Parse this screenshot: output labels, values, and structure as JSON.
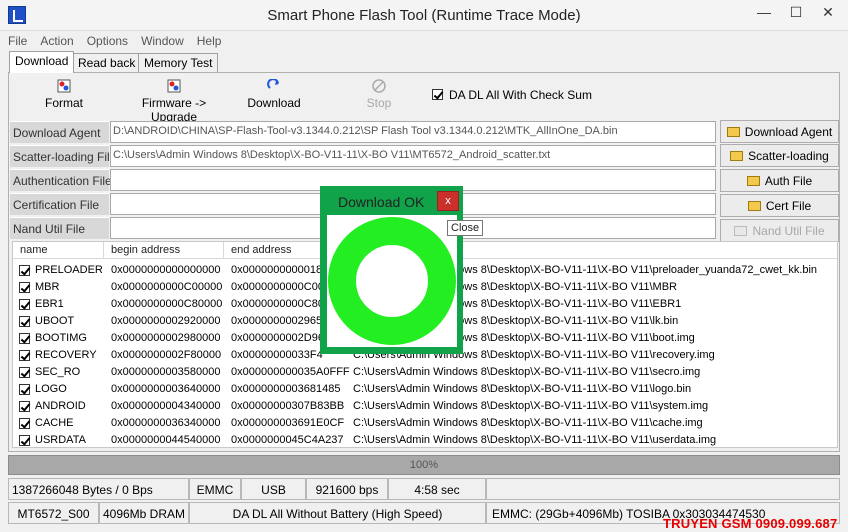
{
  "window": {
    "title": "Smart Phone Flash Tool (Runtime Trace Mode)",
    "minimize": "—",
    "maximize": "☐",
    "close": "✕"
  },
  "menu": [
    "File",
    "Action",
    "Options",
    "Window",
    "Help"
  ],
  "tabs": [
    "Download",
    "Read back",
    "Memory Test"
  ],
  "toolbar": {
    "format": "Format",
    "firmware_upgrade": "Firmware -> Upgrade",
    "download": "Download",
    "stop": "Stop",
    "checksum_label": "DA DL All With Check Sum"
  },
  "fields": [
    {
      "label": "Download Agent",
      "value": "D:\\ANDROID\\CHINA\\SP-Flash-Tool-v3.1344.0.212\\SP Flash Tool v3.1344.0.212\\MTK_AllInOne_DA.bin",
      "button": "Download Agent"
    },
    {
      "label": "Scatter-loading File",
      "value": "C:\\Users\\Admin Windows 8\\Desktop\\X-BO-V11-11\\X-BO V11\\MT6572_Android_scatter.txt",
      "button": "Scatter-loading"
    },
    {
      "label": "Authentication File",
      "value": "",
      "button": "Auth File"
    },
    {
      "label": "Certification File",
      "value": "",
      "button": "Cert File"
    },
    {
      "label": "Nand Util File",
      "value": "",
      "button": "Nand Util File"
    }
  ],
  "grid": {
    "headers": [
      "name",
      "begin address",
      "end address",
      "location"
    ],
    "rows": [
      {
        "name": "PRELOADER",
        "begin": "0x0000000000000000",
        "end": "0x000000000001812",
        "location": "C:\\Users\\Admin Windows 8\\Desktop\\X-BO-V11-11\\X-BO V11\\preloader_yuanda72_cwet_kk.bin"
      },
      {
        "name": "MBR",
        "begin": "0x0000000000C00000",
        "end": "0x0000000000C0000",
        "location": "C:\\Users\\Admin Windows 8\\Desktop\\X-BO-V11-11\\X-BO V11\\MBR"
      },
      {
        "name": "EBR1",
        "begin": "0x0000000000C80000",
        "end": "0x0000000000C8000",
        "location": "C:\\Users\\Admin Windows 8\\Desktop\\X-BO-V11-11\\X-BO V11\\EBR1"
      },
      {
        "name": "UBOOT",
        "begin": "0x0000000002920000",
        "end": "0x0000000002965",
        "location": "C:\\Users\\Admin Windows 8\\Desktop\\X-BO-V11-11\\X-BO V11\\lk.bin"
      },
      {
        "name": "BOOTIMG",
        "begin": "0x0000000002980000",
        "end": "0x0000000002D96",
        "location": "C:\\Users\\Admin Windows 8\\Desktop\\X-BO-V11-11\\X-BO V11\\boot.img"
      },
      {
        "name": "RECOVERY",
        "begin": "0x0000000002F80000",
        "end": "0x00000000033F4",
        "location": "C:\\Users\\Admin Windows 8\\Desktop\\X-BO-V11-11\\X-BO V11\\recovery.img"
      },
      {
        "name": "SEC_RO",
        "begin": "0x0000000003580000",
        "end": "0x000000000035A0FFF",
        "location": "C:\\Users\\Admin Windows 8\\Desktop\\X-BO-V11-11\\X-BO V11\\secro.img"
      },
      {
        "name": "LOGO",
        "begin": "0x0000000003640000",
        "end": "0x0000000003681485",
        "location": "C:\\Users\\Admin Windows 8\\Desktop\\X-BO-V11-11\\X-BO V11\\logo.bin"
      },
      {
        "name": "ANDROID",
        "begin": "0x0000000004340000",
        "end": "0x00000000307B83BB",
        "location": "C:\\Users\\Admin Windows 8\\Desktop\\X-BO-V11-11\\X-BO V11\\system.img"
      },
      {
        "name": "CACHE",
        "begin": "0x0000000036340000",
        "end": "0x000000003691E0CF",
        "location": "C:\\Users\\Admin Windows 8\\Desktop\\X-BO-V11-11\\X-BO V11\\cache.img"
      },
      {
        "name": "USRDATA",
        "begin": "0x0000000044540000",
        "end": "0x0000000045C4A237",
        "location": "C:\\Users\\Admin Windows 8\\Desktop\\X-BO-V11-11\\X-BO V11\\userdata.img"
      }
    ]
  },
  "progress": {
    "text": "100%",
    "fraction": 1.0
  },
  "status": {
    "row1": [
      "1387266048 Bytes / 0 Bps",
      "EMMC",
      "USB",
      "921600 bps",
      "4:58 sec"
    ],
    "row2": [
      "MT6572_S00",
      "4096Mb DRAM",
      "DA DL All Without Battery (High Speed)",
      "EMMC: (29Gb+4096Mb) TOSIBA 0x303034474530"
    ]
  },
  "dialog": {
    "title": "Download OK",
    "close_label": "x",
    "tooltip": "Close",
    "ring_color": "#22ee22"
  },
  "watermark": "TRUYEN GSM 0909.099.687"
}
